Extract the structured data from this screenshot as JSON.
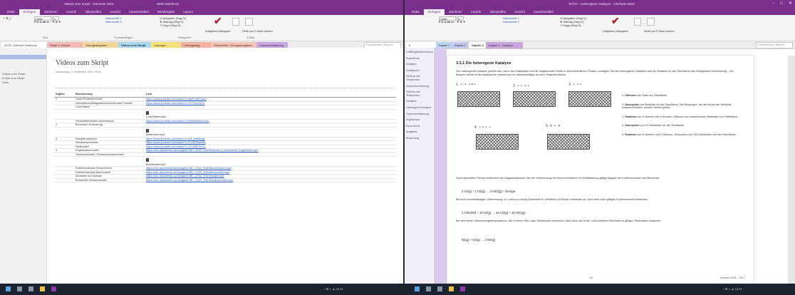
{
  "left": {
    "window_title": "Videos zum Script - OneNote 2016",
    "ribbon_context": "Seite   Notizbuch",
    "menu_tabs": [
      "Datei",
      "Einfügen",
      "Zeichnen",
      "Ansicht",
      "Überprüfen",
      "Ansicht",
      "Ausschneiden",
      "Wiedergabe",
      "Layout"
    ],
    "ribbon": {
      "paste_label": "Ausschneiden\nKopieren\nFormat übertragen",
      "font": "Calibri",
      "size": "11",
      "styles": [
        "Überschrift 1",
        "Überschrift 2"
      ],
      "tags": [
        "Aufgaben (Strg+1)",
        "Wichtig (Strg+2)",
        "Frage (Strg+3)"
      ],
      "todo_label": "Aufgaben-Kategorie",
      "find_label": "Kategorien",
      "email_label": "Seite per E-Mail senden",
      "group_labels": [
        "Text",
        "Formatvorlagen",
        "Kategorien",
        "E-Mail"
      ]
    },
    "notebook": "MTSL OneNote Notebook",
    "sections": [
      "Skript 1 Chemie",
      "Übungsaufgaben",
      "Videos zum Skript",
      "Lösungen",
      "Lösungsweg",
      "Stichwörter / Übungsaufgaben",
      "Zusammenfassung"
    ],
    "search_placeholder": "Durchsuchen (Strg+E)",
    "nav_items": [
      "Videos zum Skript",
      "Extras zum Skript",
      "Links"
    ],
    "page_title": "Videos zum Skript",
    "page_date": "Donnerstag, 2. Dezember 2021     19:03",
    "table_headers": [
      "Kapitel",
      "Bezeichnung",
      "Link"
    ],
    "rows": [
      {
        "k": "1",
        "b": "Lewis-Protonenmodell",
        "l": "https://www.youtube.com/watch?v=3jw0XoRCxwU"
      },
      {
        "k": "",
        "b": "Lithiumfluorid/Magnesiumchlorid/Lewis Formeln",
        "l": "https://www.youtube.com/watch?v=9TPTcyN3GrI"
      },
      {
        "k": "",
        "b": "Cola-Rätsel",
        "l": ""
      },
      {
        "k": "",
        "b": "",
        "l": "Cola-Rätsel.mp4"
      },
      {
        "k": "",
        "b": "Farbstoffe/Farben/Laborversuch",
        "l": "https://www.youtube.com/watch?v=W0e0ekRoXcmU"
      },
      {
        "k": "2",
        "b": "Bohrmann-Umsetzung",
        "l": ""
      },
      {
        "k": "",
        "b": "",
        "l": "Elektronen.mp4"
      },
      {
        "k": "3",
        "b": "Dampfdruckkurve",
        "l": "https://www.youtube.com/watch?v=eN_4wbfWqjs"
      },
      {
        "k": "",
        "b": "Siedetemperaturen",
        "l": "https://www.youtube.com/watch?v=PuJ9K5ta0Ws"
      },
      {
        "k": "",
        "b": "Pfeilmodell",
        "l": "https://www.youtube.com/watch?v=JCU8rfiVHrOo"
      },
      {
        "k": "4",
        "b": "Kugelwolkenmodell",
        "l": "https://cdn.dokumente.zum/pages/CIBC_2018_Teil2/Rutherford_Experiment_Ergebnisse.mp4"
      },
      {
        "k": "",
        "b": "Thomsonmodell / Rosinenkuchenmodell",
        "l": ""
      },
      {
        "k": "",
        "b": "",
        "l": "Bohrmodell.mp4"
      },
      {
        "k": "",
        "b": "Rutherfordsches Streuversuch",
        "l": "https://cdn.dokumente.zum/pages/CIBC_2018_Teil2/Streuversuch.mp4"
      },
      {
        "k": "",
        "b": "Rutherfordsches Atommodell",
        "l": "https://cdn.dokumente.zum/pages/CIBC_2018_Teil2/Atommodell.mp4"
      },
      {
        "k": "",
        "b": "Atomkern und Isotope",
        "l": "https://cdn.dokumente.zum/pages/CIBC_2018_Teil2/Isotope.mp4"
      },
      {
        "k": "",
        "b": "Bohrsches Schalenmodell",
        "l": "https://cdn.dokumente.zum/pages/CIBC_2018_Teil2/Schalenmodell.mp4"
      }
    ]
  },
  "right": {
    "window_title": "Teil 5T - Heterogene Katalyse - OneNote 2016",
    "menu_tabs": [
      "Datei",
      "Einfügen",
      "Zeichnen",
      "Ansicht",
      "Überprüfen",
      "Ansicht",
      "Ausschneiden"
    ],
    "sections": [
      "Kapitel 1",
      "Kapitel 2",
      "Kapitel 3",
      "Kapitel 4 - Katalyse"
    ],
    "search_placeholder": "Durchsuchen (Strg+E)",
    "nav_items": [
      "Leitfähigkeitsmessung",
      "Ergebnisse",
      "Katalyse",
      "Katalysator",
      "Einfluss der Temperatur",
      "Zusammenfassung",
      "Einfluss der Temperatur",
      "Katalyse",
      "Heterogene Katalyse",
      "Zusammenfassung",
      "Ergebnisse",
      "Experiment",
      "Aufgaben",
      "Bewertung"
    ],
    "heading": "3.3.1  Die heterogene Katalyse",
    "intro": "Von heterogener Katalyse spricht man, wenn der Katalysator und die reagierenden Stoffe in unterschiedlichen Phasen vorliegen. Bei der heterogenen Katalyse wird die Reaktion an der Oberfläche des Katalysators beschleunigt – ein Beispiel hierfür ist die katalytische Hydrierung von Wasserstoffgas an einer Platinoberfläche.",
    "steps": [
      {
        "n": "1.",
        "bold": "Diffusion",
        "rest": " der Gase zur Oberfläche."
      },
      {
        "n": "2.",
        "bold": "Adsorption",
        "rest": " der Moleküle an der Oberfläche. Die Bindungen, die die Atome der Moleküle zusammenhalten, werden hierbei gelöst."
      },
      {
        "n": "3.",
        "bold": "Reaktion",
        "rest": " von H-Atomen mit O-Atomen. Diffusion von entstehenden Molekülen zur Oberfläche."
      },
      {
        "n": "4.",
        "bold": "Adsorption",
        "rest": " von H2-Molekülen an die Oberfläche."
      },
      {
        "n": "5.",
        "bold": "Reaktion",
        "rest": " von H-Atomen und O-Atomen. Desorption von H2O-Molekülen von der Oberfläche."
      }
    ],
    "para2": "Nach demselben Prinzip funktioniert der Abgaskatalysator. Bei der Verbrennung von Benzin entstehen im Kraftfahrzeug giftige Abgase wie Kohlenmonoxid und Stickoxide:",
    "eq1": "2 H2(g) + 1 O2(g)  →  2 H2O(g) + Energie",
    "para3": "Bei einer unvollständigen Verbrennung, d.h. wenn zu wenig Sauerstoff im Verhältnis zu Benzin vorhanden ist, kann aber auch giftiges Kohlenmonoxid entstehen:",
    "eq2": "2 C8H18(l) + 19 O2(g)  →  16 CO(g) + 18 H2O(g)",
    "para4": "Bei den hohen Verbrennungstemperaturen, die in einem Otto- oder Dieselmotor herrschen, kann auch der in der Luft enthaltene Stickstoff zu giftigen Stickoxiden reagieren:",
    "eq3": "N2(g) + O2(g)  →  2 NO(g)",
    "page_number": "81",
    "footer_right": "Hansen 2016 – 2017"
  },
  "colors": {
    "accent": "#7a2f8c",
    "link": "#1f56b5",
    "selected": "#a9b6e8",
    "taskbar": "#1b2230"
  },
  "taskbar": {
    "icons": [
      "windows-icon",
      "search-icon",
      "task-view-icon",
      "file-explorer-icon",
      "onenote-icon"
    ],
    "tray_left": "^ ⊞ ♫ ▲ 15:31",
    "tray_right": "^ ⊞ ♫ ▲ 15:31"
  }
}
